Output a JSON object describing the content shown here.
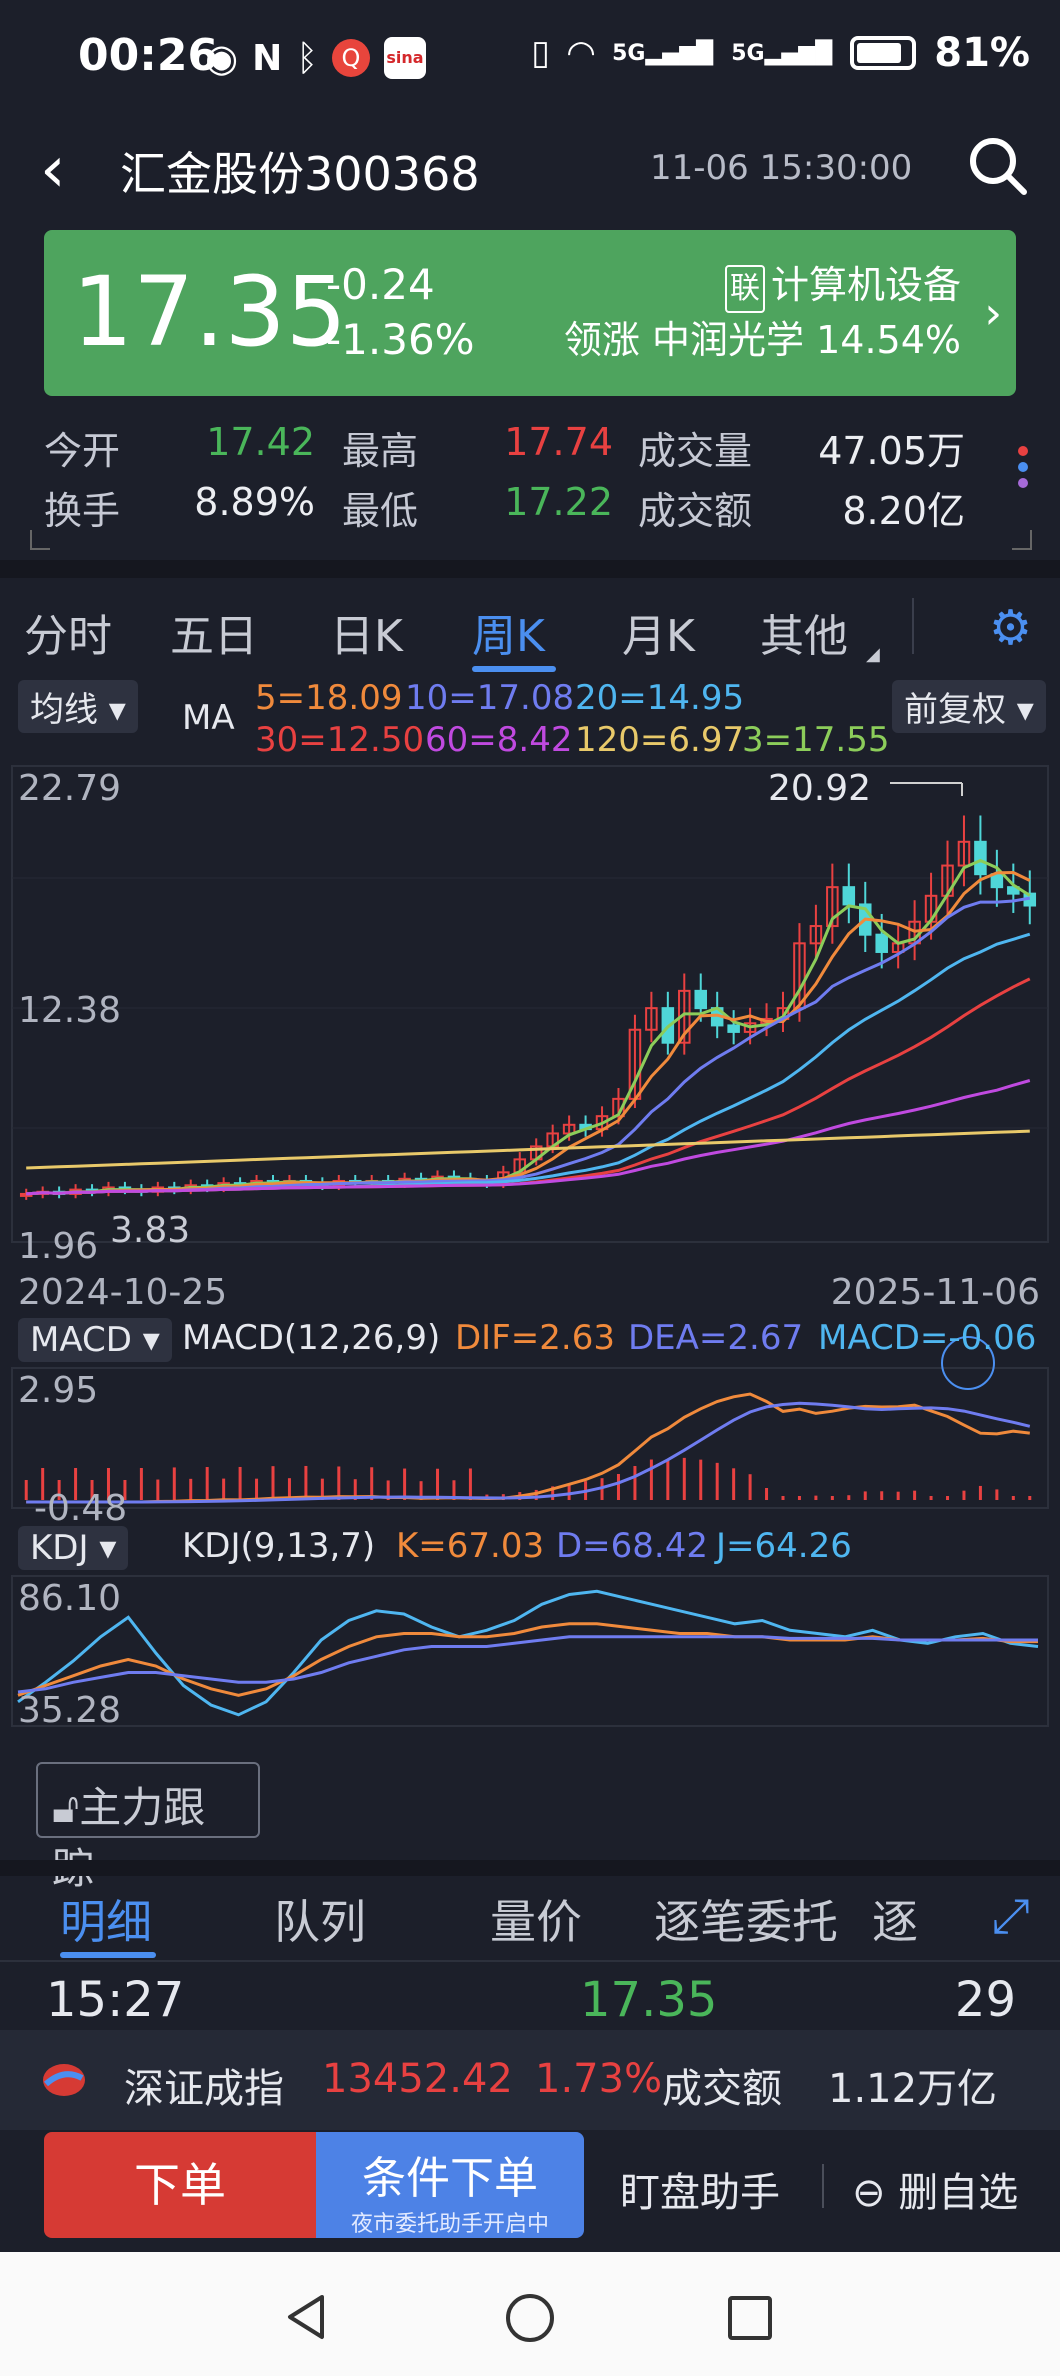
{
  "status": {
    "time": "00:26",
    "battery": "81%",
    "net1": "5G",
    "net2": "5G"
  },
  "header": {
    "title": "汇金股份300368",
    "datetime": "11-06 15:30:00"
  },
  "quote": {
    "price": "17.35",
    "change": "-0.24",
    "change_pct": "-1.36%",
    "industry_tag": "联",
    "industry": "计算机设备",
    "leader_label": "领涨",
    "leader_name": "中润光学",
    "leader_pct": "14.54%"
  },
  "stats": {
    "open_label": "今开",
    "open": "17.42",
    "high_label": "最高",
    "high": "17.74",
    "volume_label": "成交量",
    "volume": "47.05万",
    "turnover_label": "换手",
    "turnover": "8.89%",
    "low_label": "最低",
    "low": "17.22",
    "amount_label": "成交额",
    "amount": "8.20亿"
  },
  "tabs": [
    "分时",
    "五日",
    "日K",
    "周K",
    "月K",
    "其他"
  ],
  "active_tab": "周K",
  "ma_panel": {
    "dropdown": "均线",
    "name": "MA",
    "fq": "前复权",
    "ma5": "5=18.09",
    "ma10": "10=17.08",
    "ma20": "20=14.95",
    "ma30": "30=12.50",
    "ma60": "60=8.42",
    "ma120": "120=6.97",
    "ma3": "3=17.55",
    "y_top": "22.79",
    "y_mid": "12.38",
    "y_low": "1.96",
    "min_label": "3.83",
    "max_label": "20.92",
    "date_start": "2024-10-25",
    "date_end": "2025-11-06"
  },
  "macd_panel": {
    "dropdown": "MACD",
    "name": "MACD(12,26,9)",
    "dif": "DIF=2.63",
    "dea": "DEA=2.67",
    "macd": "MACD=-0.06",
    "y_top": "2.95",
    "y_low": "-0.48"
  },
  "kdj_panel": {
    "dropdown": "KDJ",
    "name": "KDJ(9,13,7)",
    "k": "K=67.03",
    "d": "D=68.42",
    "j": "J=64.26",
    "y_top": "86.10",
    "y_low": "35.28"
  },
  "track_button": "主力跟踪",
  "detail_tabs": [
    "明细",
    "队列",
    "量价",
    "逐笔委托",
    "逐"
  ],
  "trade": {
    "time": "15:27",
    "price": "17.35",
    "volume": "29"
  },
  "index_bar": {
    "name": "深证成指",
    "value": "13452.42",
    "pct": "1.73%",
    "amount_label": "成交额",
    "amount": "1.12万亿"
  },
  "actions": {
    "order": "下单",
    "conditional": "条件下单",
    "conditional_sub": "夜市委托助手开启中",
    "assistant": "盯盘助手",
    "remove": "删自选"
  },
  "colors": {
    "up": "#e84141",
    "down": "#4ab65a",
    "accent": "#4b8ff0",
    "card": "#4ea45e"
  },
  "chart_data": [
    {
      "type": "candlestick",
      "title": "",
      "xlabel": "",
      "ylabel": "",
      "x_range": [
        "2024-10-25",
        "2025-11-06"
      ],
      "ylim": [
        1.96,
        22.79
      ],
      "price_extremes": {
        "high": 20.92,
        "low": 3.83
      },
      "weekly_close_approx": [
        4.0,
        4.1,
        4.0,
        4.2,
        4.1,
        4.3,
        4.2,
        4.1,
        4.3,
        4.2,
        4.4,
        4.3,
        4.5,
        4.4,
        4.6,
        4.5,
        4.6,
        4.5,
        4.4,
        4.6,
        4.5,
        4.6,
        4.5,
        4.7,
        4.6,
        4.8,
        4.7,
        4.6,
        4.5,
        5.0,
        5.6,
        6.2,
        6.8,
        7.2,
        7.0,
        7.6,
        8.4,
        11.6,
        12.6,
        11.0,
        13.4,
        12.6,
        11.8,
        11.5,
        11.9,
        12.1,
        12.6,
        15.6,
        16.4,
        18.2,
        17.4,
        16.0,
        15.2,
        15.6,
        16.6,
        17.8,
        19.2,
        20.3,
        18.8,
        18.2,
        17.9,
        17.35
      ],
      "ma_latest": {
        "MA3": 17.55,
        "MA5": 18.09,
        "MA10": 17.08,
        "MA20": 14.95,
        "MA30": 12.5,
        "MA60": 8.42,
        "MA120": 6.97
      }
    },
    {
      "type": "line",
      "title": "MACD(12,26,9)",
      "ylim": [
        -0.48,
        2.95
      ],
      "latest": {
        "DIF": 2.63,
        "DEA": 2.67,
        "MACD": -0.06
      }
    },
    {
      "type": "line",
      "title": "KDJ(9,13,7)",
      "ylim": [
        35.28,
        86.1
      ],
      "latest": {
        "K": 67.03,
        "D": 68.42,
        "J": 64.26
      }
    }
  ]
}
